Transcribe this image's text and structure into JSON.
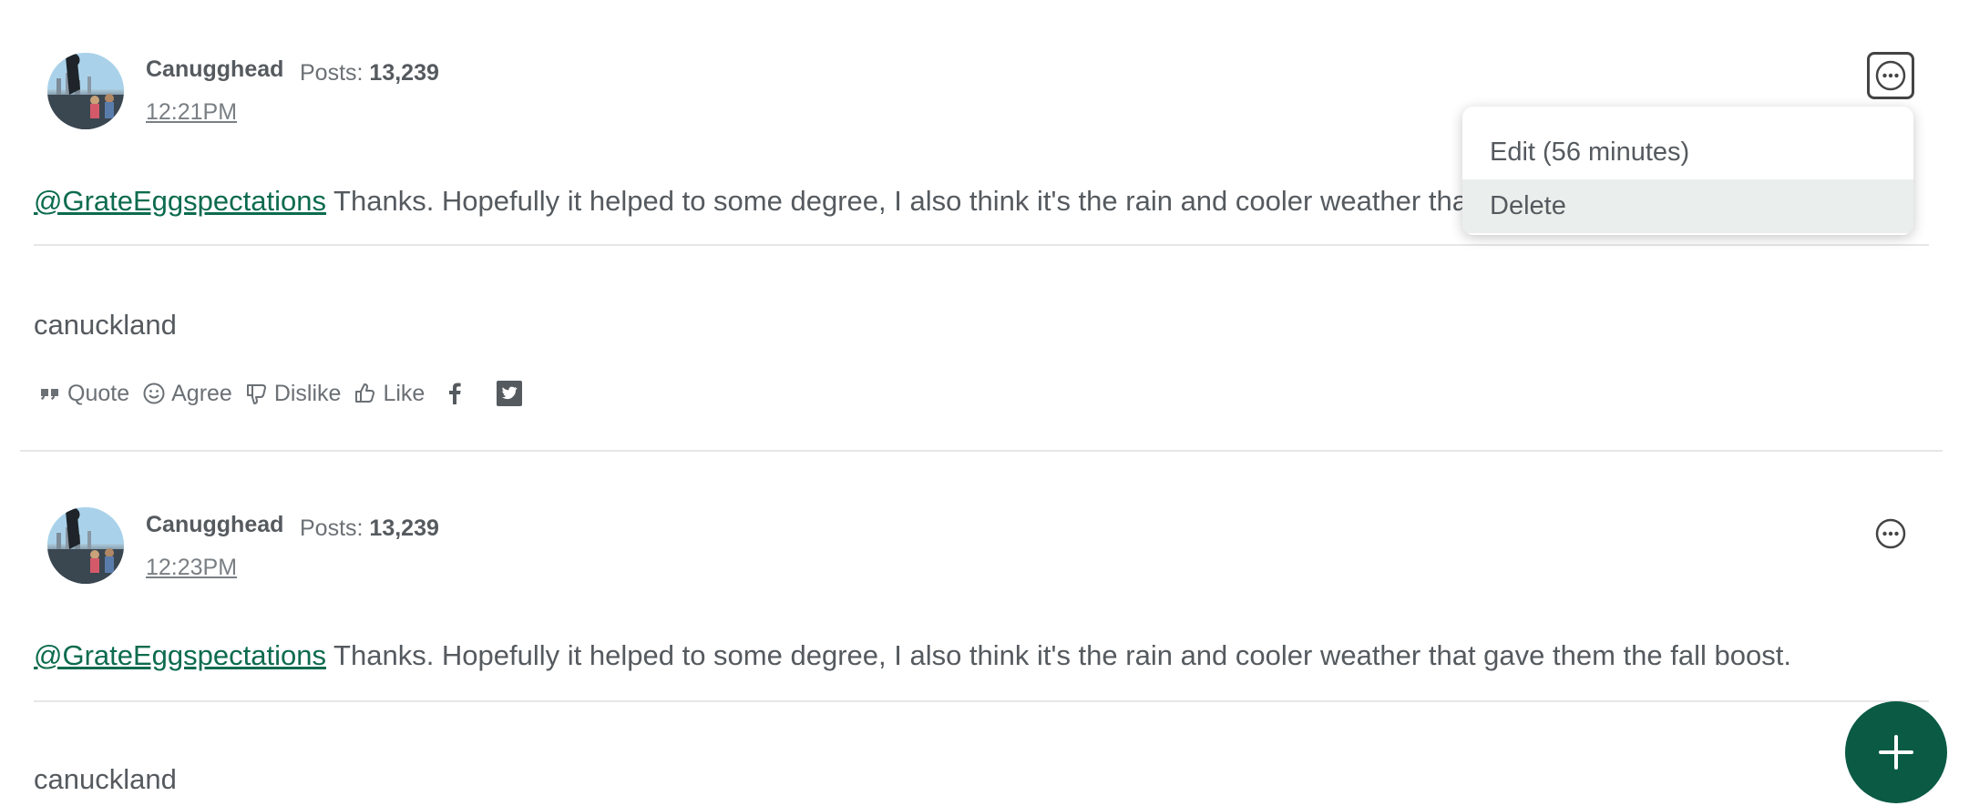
{
  "posts": [
    {
      "author": "Canugghead",
      "posts_label": "Posts: ",
      "posts_count": "13,239",
      "timestamp": "12:21PM",
      "mention": "@GrateEggspectations",
      "body": " Thanks. Hopefully it helped to some degree, I also think it's the rain and cooler weather that gave them the fall boost.",
      "signature": "canuckland",
      "actions": {
        "quote": "Quote",
        "agree": "Agree",
        "dislike": "Dislike",
        "like": "Like"
      }
    },
    {
      "author": "Canugghead",
      "posts_label": "Posts: ",
      "posts_count": "13,239",
      "timestamp": "12:23PM",
      "mention": "@GrateEggspectations",
      "body": " Thanks. Hopefully it helped to some degree, I also think it's the rain and cooler weather that gave them the fall boost.",
      "signature": "canuckland"
    }
  ],
  "options_menu": {
    "edit": "Edit (56 minutes)",
    "delete": "Delete"
  },
  "icons": {
    "options": "ellipsis-circle-icon",
    "quote": "quote-icon",
    "agree": "smiley-icon",
    "dislike": "thumbs-down-icon",
    "like": "thumbs-up-icon",
    "facebook": "facebook-icon",
    "twitter": "twitter-icon",
    "fab": "plus-icon"
  },
  "colors": {
    "accent": "#0a5a44",
    "link": "#0c6b4e",
    "text": "#555a5f",
    "menu_highlight": "#eaeeec"
  }
}
